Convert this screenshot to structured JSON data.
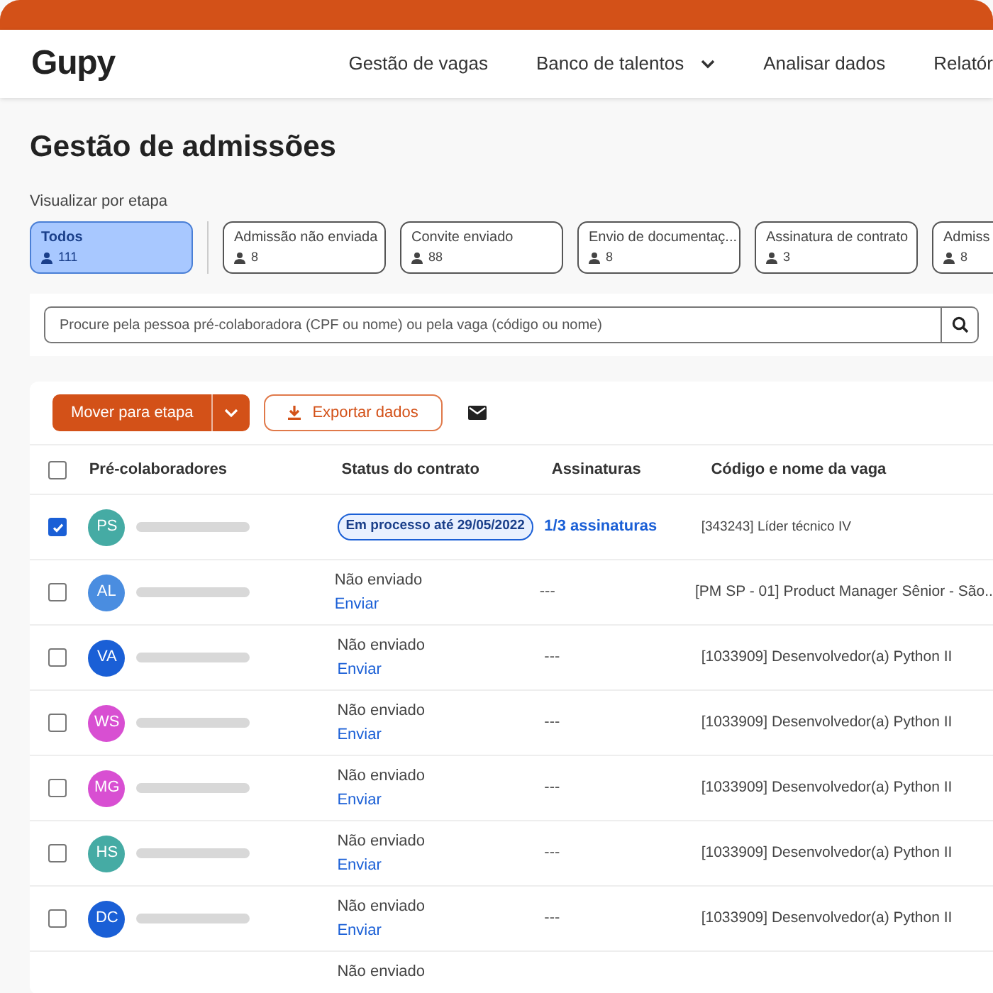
{
  "header": {
    "logo": "Gupy",
    "nav": [
      {
        "label": "Gestão de vagas",
        "dropdown": false
      },
      {
        "label": "Banco de talentos",
        "dropdown": true
      },
      {
        "label": "Analisar dados",
        "dropdown": false
      },
      {
        "label": "Relatór",
        "dropdown": false
      }
    ]
  },
  "title": "Gestão de admissões",
  "stages_label": "Visualizar por etapa",
  "stages": [
    {
      "label": "Todos",
      "count": "111",
      "selected": true
    },
    {
      "label": "Admissão não enviada",
      "count": "8",
      "selected": false
    },
    {
      "label": "Convite enviado",
      "count": "88",
      "selected": false
    },
    {
      "label": "Envio de documentaç...",
      "count": "8",
      "selected": false
    },
    {
      "label": "Assinatura de contrato",
      "count": "3",
      "selected": false
    },
    {
      "label": "Admiss",
      "count": "8",
      "selected": false
    }
  ],
  "search": {
    "placeholder": "Procure pela pessoa pré-colaboradora (CPF ou nome) ou pela vaga (código ou nome)"
  },
  "toolbar": {
    "move_button": "Mover para etapa",
    "export_button": "Exportar dados"
  },
  "table": {
    "select_all_checked": false,
    "columns": [
      "Pré-colaboradores",
      "Status do contrato",
      "Assinaturas",
      "Código e nome da vaga"
    ],
    "rows": [
      {
        "checked": true,
        "initials": "PS",
        "color": "#45aba4",
        "status_badge": "Em processo até  29/05/2022",
        "signatures_link": "1/3 assinaturas",
        "vaga": "[343243] Líder técnico IV"
      },
      {
        "checked": false,
        "initials": "AL",
        "color": "#4a8de0",
        "status": "Não enviado",
        "action": "Enviar",
        "signatures": "---",
        "vaga": "[PM SP - 01] Product Manager Sênior - São..."
      },
      {
        "checked": false,
        "initials": "VA",
        "color": "#1a5fd6",
        "status": "Não enviado",
        "action": "Enviar",
        "signatures": "---",
        "vaga": "[1033909] Desenvolvedor(a) Python II"
      },
      {
        "checked": false,
        "initials": "WS",
        "color": "#d84fd2",
        "status": "Não enviado",
        "action": "Enviar",
        "signatures": "---",
        "vaga": "[1033909] Desenvolvedor(a) Python II"
      },
      {
        "checked": false,
        "initials": "MG",
        "color": "#d84fd2",
        "status": "Não enviado",
        "action": "Enviar",
        "signatures": "---",
        "vaga": "[1033909] Desenvolvedor(a) Python II"
      },
      {
        "checked": false,
        "initials": "HS",
        "color": "#45aba4",
        "status": "Não enviado",
        "action": "Enviar",
        "signatures": "---",
        "vaga": "[1033909] Desenvolvedor(a) Python II"
      },
      {
        "checked": false,
        "initials": "DC",
        "color": "#1a5fd6",
        "status": "Não enviado",
        "action": "Enviar",
        "signatures": "---",
        "vaga": "[1033909] Desenvolvedor(a) Python II"
      },
      {
        "status": "Não enviado"
      }
    ]
  }
}
